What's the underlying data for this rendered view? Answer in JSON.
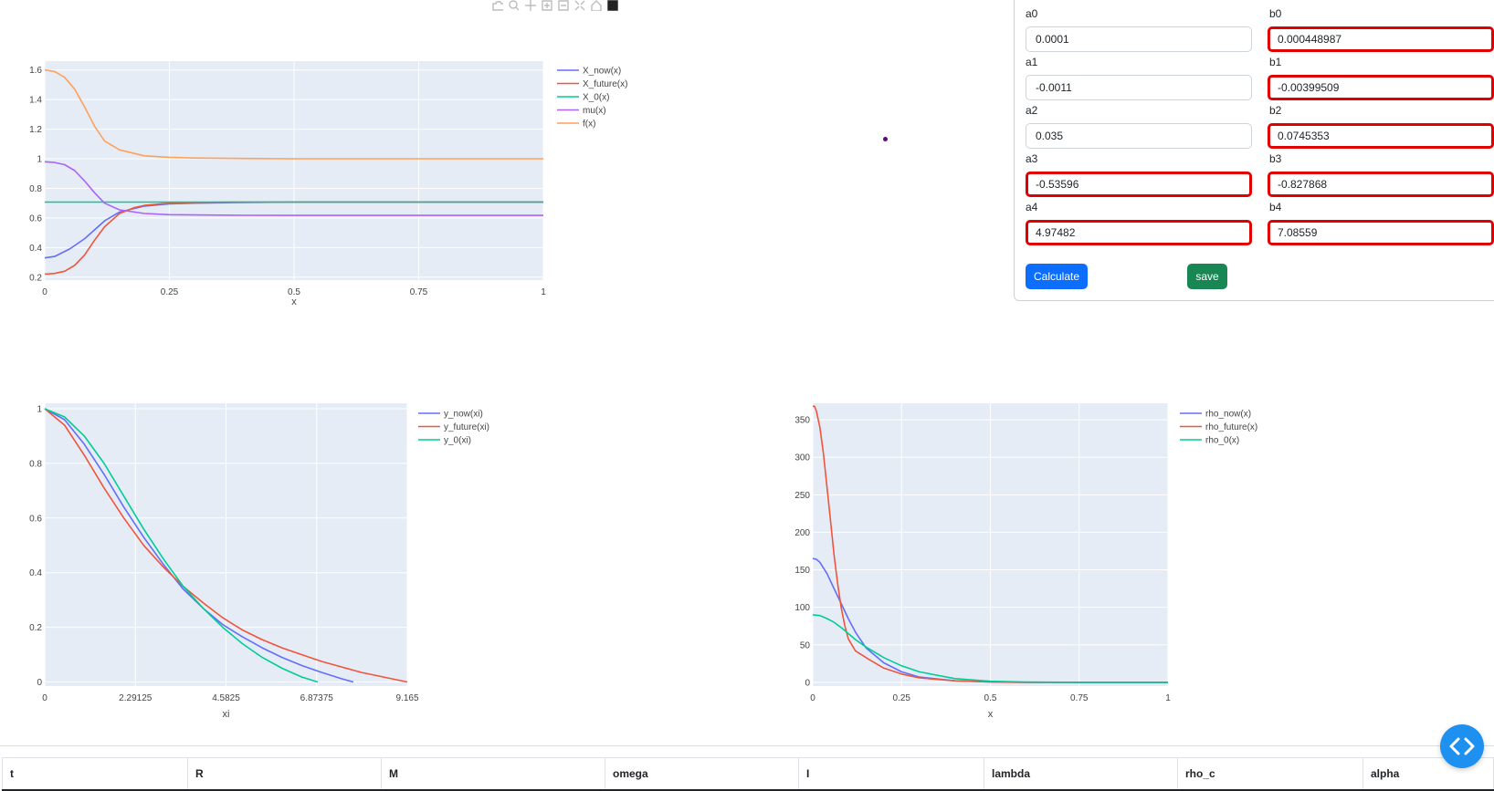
{
  "colors": {
    "plot_bg": "#e5ecf6",
    "blue": "#636efa",
    "red": "#ef553b",
    "green": "#00cc96",
    "purple": "#ab63fa",
    "orange": "#ffa15a",
    "invalid_border": "#e00000",
    "calculate_button": "#0d6efd",
    "save_button": "#198754"
  },
  "modebar": {
    "icons": [
      "camera-icon",
      "zoom-icon",
      "pan-icon",
      "zoom-in-icon",
      "zoom-out-icon",
      "autoscale-icon",
      "home-icon",
      "plotly-logo-icon"
    ]
  },
  "params": {
    "a": [
      {
        "label": "a0",
        "value": "0.0001",
        "invalid": false
      },
      {
        "label": "a1",
        "value": "-0.0011",
        "invalid": false
      },
      {
        "label": "a2",
        "value": "0.035",
        "invalid": false
      },
      {
        "label": "a3",
        "value": "-0.53596",
        "invalid": true
      },
      {
        "label": "a4",
        "value": "4.97482",
        "invalid": true
      }
    ],
    "b": [
      {
        "label": "b0",
        "value": "0.000448987",
        "invalid": true
      },
      {
        "label": "b1",
        "value": "-0.00399509",
        "invalid": true
      },
      {
        "label": "b2",
        "value": "0.0745353",
        "invalid": true
      },
      {
        "label": "b3",
        "value": "-0.827868",
        "invalid": true
      },
      {
        "label": "b4",
        "value": "7.08559",
        "invalid": true
      }
    ],
    "calculate_label": "Calculate",
    "save_label": "save"
  },
  "table": {
    "headers": [
      "t",
      "R",
      "M",
      "omega",
      "I",
      "lambda",
      "rho_c",
      "alpha"
    ]
  },
  "chart_data": [
    {
      "type": "line",
      "xlabel": "x",
      "x_ticks": [
        0,
        0.25,
        0.5,
        0.75,
        1
      ],
      "x_tick_labels": [
        "0",
        "0.25",
        "0.5",
        "0.75",
        "1"
      ],
      "y_ticks": [
        0.2,
        0.4,
        0.6,
        0.8,
        1,
        1.2,
        1.4,
        1.6
      ],
      "y_tick_labels": [
        "0.2",
        "0.4",
        "0.6",
        "0.8",
        "1",
        "1.2",
        "1.4",
        "1.6"
      ],
      "xlim": [
        0,
        1
      ],
      "ylim": [
        0.18,
        1.66
      ],
      "grid": true,
      "legend_position": "right",
      "series": [
        {
          "name": "X_now(x)",
          "color": "#636efa",
          "x": [
            0,
            0.02,
            0.05,
            0.08,
            0.1,
            0.12,
            0.15,
            0.2,
            0.25,
            0.3,
            0.4,
            0.5,
            0.75,
            1
          ],
          "y": [
            0.33,
            0.34,
            0.39,
            0.46,
            0.52,
            0.58,
            0.64,
            0.68,
            0.695,
            0.7,
            0.705,
            0.707,
            0.707,
            0.707
          ]
        },
        {
          "name": "X_future(x)",
          "color": "#ef553b",
          "x": [
            0,
            0.02,
            0.04,
            0.06,
            0.08,
            0.1,
            0.12,
            0.15,
            0.18,
            0.2,
            0.25,
            0.3,
            0.4,
            0.5,
            0.75,
            1
          ],
          "y": [
            0.22,
            0.225,
            0.24,
            0.28,
            0.35,
            0.45,
            0.54,
            0.63,
            0.67,
            0.685,
            0.7,
            0.705,
            0.707,
            0.707,
            0.707,
            0.707
          ]
        },
        {
          "name": "X_0(x)",
          "color": "#00cc96",
          "x": [
            0,
            0.25,
            0.5,
            0.75,
            1
          ],
          "y": [
            0.707,
            0.707,
            0.707,
            0.707,
            0.707
          ]
        },
        {
          "name": "mu(x)",
          "color": "#ab63fa",
          "x": [
            0,
            0.02,
            0.04,
            0.06,
            0.08,
            0.1,
            0.12,
            0.15,
            0.2,
            0.25,
            0.3,
            0.4,
            0.5,
            0.75,
            1
          ],
          "y": [
            0.98,
            0.975,
            0.96,
            0.92,
            0.85,
            0.77,
            0.7,
            0.655,
            0.63,
            0.622,
            0.62,
            0.618,
            0.617,
            0.617,
            0.617
          ]
        },
        {
          "name": "f(x)",
          "color": "#ffa15a",
          "x": [
            0,
            0.02,
            0.04,
            0.06,
            0.08,
            0.1,
            0.12,
            0.15,
            0.2,
            0.25,
            0.3,
            0.4,
            0.5,
            0.75,
            1
          ],
          "y": [
            1.6,
            1.59,
            1.55,
            1.47,
            1.35,
            1.22,
            1.12,
            1.06,
            1.02,
            1.01,
            1.005,
            1.002,
            1.0,
            1.0,
            1.0
          ]
        }
      ]
    },
    {
      "type": "line",
      "xlabel": "xi",
      "x_ticks": [
        0,
        2.29125,
        4.5825,
        6.87375,
        9.165
      ],
      "x_tick_labels": [
        "0",
        "2.29125",
        "4.5825",
        "6.87375",
        "9.165"
      ],
      "y_ticks": [
        0,
        0.2,
        0.4,
        0.6,
        0.8,
        1
      ],
      "y_tick_labels": [
        "0",
        "0.2",
        "0.4",
        "0.6",
        "0.8",
        "1"
      ],
      "xlim": [
        0,
        9.165
      ],
      "ylim": [
        -0.015,
        1.02
      ],
      "grid": true,
      "legend_position": "right",
      "series": [
        {
          "name": "y_now(xi)",
          "color": "#636efa",
          "x": [
            0,
            0.5,
            1,
            1.5,
            2,
            2.5,
            3,
            3.5,
            4,
            4.5,
            5,
            5.5,
            6,
            6.5,
            7,
            7.5,
            7.8
          ],
          "y": [
            1,
            0.96,
            0.87,
            0.76,
            0.64,
            0.53,
            0.43,
            0.34,
            0.27,
            0.21,
            0.165,
            0.125,
            0.09,
            0.06,
            0.035,
            0.012,
            0
          ]
        },
        {
          "name": "y_future(xi)",
          "color": "#ef553b",
          "x": [
            0,
            0.5,
            1,
            1.5,
            2,
            2.5,
            3,
            3.5,
            4,
            4.5,
            5,
            5.5,
            6,
            6.5,
            7,
            7.5,
            8,
            8.5,
            9.165
          ],
          "y": [
            1,
            0.94,
            0.83,
            0.71,
            0.6,
            0.5,
            0.42,
            0.35,
            0.29,
            0.235,
            0.19,
            0.155,
            0.125,
            0.1,
            0.075,
            0.055,
            0.035,
            0.02,
            0
          ]
        },
        {
          "name": "y_0(xi)",
          "color": "#00cc96",
          "x": [
            0,
            0.5,
            1,
            1.5,
            2,
            2.5,
            3,
            3.5,
            4,
            4.5,
            5,
            5.5,
            6,
            6.5,
            6.9
          ],
          "y": [
            1,
            0.97,
            0.9,
            0.8,
            0.68,
            0.56,
            0.45,
            0.35,
            0.27,
            0.2,
            0.14,
            0.09,
            0.05,
            0.018,
            0
          ]
        }
      ]
    },
    {
      "type": "line",
      "xlabel": "x",
      "x_ticks": [
        0,
        0.25,
        0.5,
        0.75,
        1
      ],
      "x_tick_labels": [
        "0",
        "0.25",
        "0.5",
        "0.75",
        "1"
      ],
      "y_ticks": [
        0,
        50,
        100,
        150,
        200,
        250,
        300,
        350
      ],
      "y_tick_labels": [
        "0",
        "50",
        "100",
        "150",
        "200",
        "250",
        "300",
        "350"
      ],
      "xlim": [
        0,
        1
      ],
      "ylim": [
        -5,
        372
      ],
      "grid": true,
      "legend_position": "right",
      "series": [
        {
          "name": "rho_now(x)",
          "color": "#636efa",
          "x": [
            0,
            0.01,
            0.02,
            0.04,
            0.06,
            0.08,
            0.1,
            0.12,
            0.15,
            0.2,
            0.25,
            0.3,
            0.4,
            0.5,
            0.6,
            0.75,
            1
          ],
          "y": [
            165,
            164,
            160,
            145,
            125,
            105,
            85,
            67,
            46,
            26,
            14,
            7,
            2,
            0.5,
            0,
            0,
            0
          ]
        },
        {
          "name": "rho_future(x)",
          "color": "#ef553b",
          "x": [
            0,
            0.005,
            0.01,
            0.02,
            0.03,
            0.04,
            0.05,
            0.06,
            0.07,
            0.08,
            0.09,
            0.1,
            0.12,
            0.14,
            0.16,
            0.2,
            0.25,
            0.3,
            0.4,
            0.5,
            0.6,
            0.75,
            1
          ],
          "y": [
            368,
            368,
            362,
            340,
            305,
            260,
            215,
            170,
            132,
            100,
            76,
            58,
            42,
            36,
            30,
            19,
            11,
            6,
            2,
            0.5,
            0,
            0,
            0
          ]
        },
        {
          "name": "rho_0(x)",
          "color": "#00cc96",
          "x": [
            0,
            0.02,
            0.04,
            0.06,
            0.08,
            0.1,
            0.12,
            0.15,
            0.2,
            0.25,
            0.3,
            0.4,
            0.5,
            0.6,
            0.75,
            1
          ],
          "y": [
            90,
            89,
            85,
            80,
            73,
            65,
            57,
            47,
            33,
            22,
            14,
            5,
            1.5,
            0.3,
            0,
            0
          ]
        }
      ]
    }
  ]
}
